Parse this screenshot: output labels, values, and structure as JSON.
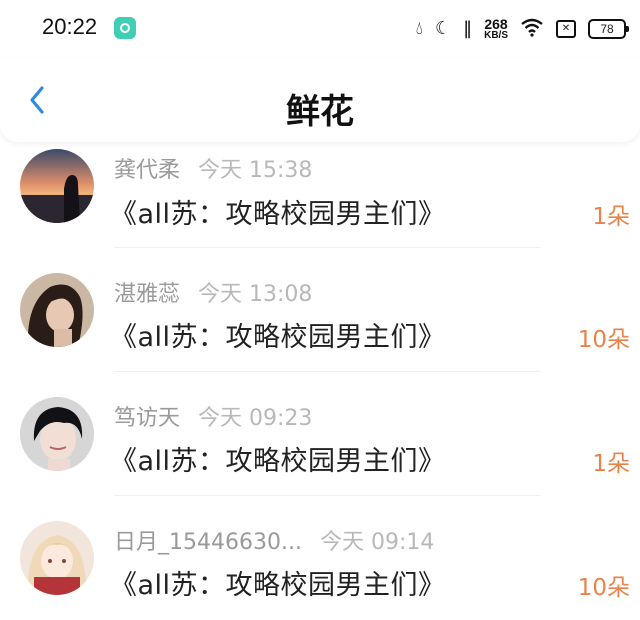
{
  "status_bar": {
    "time": "20:22",
    "net_speed": "268",
    "net_unit": "KB/S",
    "battery": "78"
  },
  "header": {
    "title": "鲜花"
  },
  "colors": {
    "back_arrow": "#2f8cde",
    "amount": "#e8834a",
    "meta_text": "#9a9a9a"
  },
  "records": [
    {
      "name": "龚代柔",
      "date": "今天 15:38",
      "book": "《all苏：攻略校园男主们》",
      "amount": "1朵"
    },
    {
      "name": "湛雅蕊",
      "date": "今天 13:08",
      "book": "《all苏：攻略校园男主们》",
      "amount": "10朵"
    },
    {
      "name": "笃访天",
      "date": "今天 09:23",
      "book": "《all苏：攻略校园男主们》",
      "amount": "1朵"
    },
    {
      "name": "日月_15446630...",
      "date": "今天 09:14",
      "book": "《all苏：攻略校园男主们》",
      "amount": "10朵"
    }
  ]
}
